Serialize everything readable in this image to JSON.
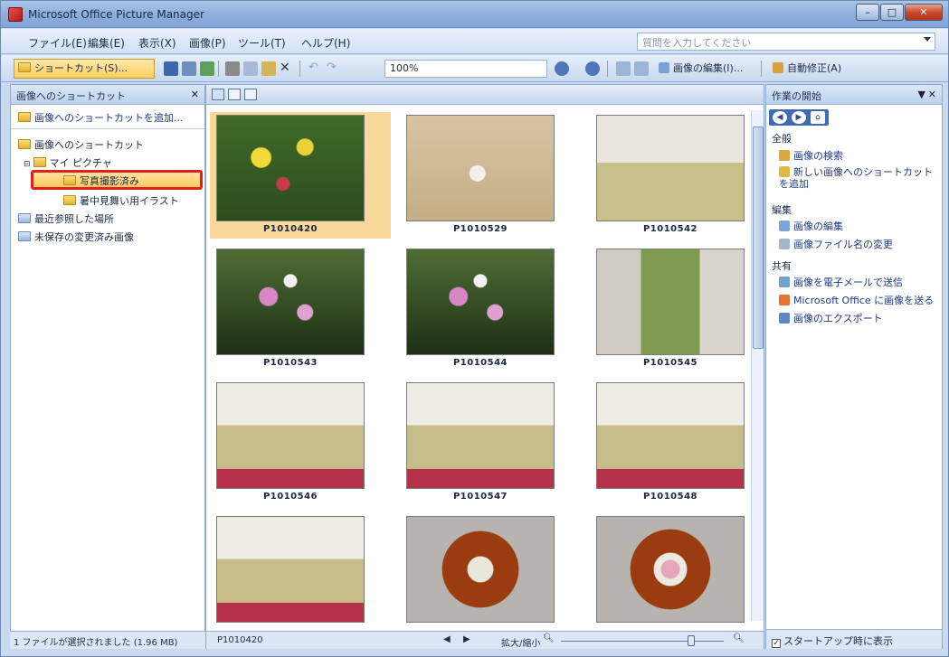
{
  "window": {
    "title": "Microsoft Office Picture Manager"
  },
  "menu": {
    "items": [
      "ファイル(E)",
      "編集(E)",
      "表示(X)",
      "画像(P)",
      "ツール(T)",
      "ヘルプ(H)"
    ],
    "help_placeholder": "質問を入力してください"
  },
  "toolbar": {
    "shortcut_label": "ショートカット(S)...",
    "zoom_value": "100%",
    "edit_label": "画像の編集(I)...",
    "autofix_label": "自動修正(A)"
  },
  "left_pane": {
    "title": "画像へのショートカット",
    "add_link": "画像へのショートカットを追加...",
    "tree": {
      "root": "画像へのショートカット",
      "my_pictures": "マイ ピクチャ",
      "selected_folder": "写真撮影済み",
      "sub_folder": "暑中見舞い用イラスト",
      "recent": "最近参照した場所",
      "unsaved": "未保存の変更済み画像"
    },
    "status": "1 ファイルが選択されました (1.96 MB)"
  },
  "thumbnails": [
    {
      "label": "P1010420",
      "scene": "flowers-yellow"
    },
    {
      "label": "P1010529",
      "scene": "ikebana"
    },
    {
      "label": "P1010542",
      "scene": "tatami-room"
    },
    {
      "label": "P1010543",
      "scene": "pink-flowers"
    },
    {
      "label": "P1010544",
      "scene": "pink-flowers"
    },
    {
      "label": "P1010545",
      "scene": "planter"
    },
    {
      "label": "P1010546",
      "scene": "tatami-people"
    },
    {
      "label": "P1010547",
      "scene": "tatami-people"
    },
    {
      "label": "P1010548",
      "scene": "tatami-people"
    },
    {
      "label": "",
      "scene": "tatami-people"
    },
    {
      "label": "",
      "scene": "wagashi-green"
    },
    {
      "label": "",
      "scene": "wagashi-pink"
    }
  ],
  "center_status": {
    "filename": "P1010420",
    "zoom_label": "拡大/縮小"
  },
  "right_pane": {
    "title": "作業の開始",
    "section_search": "全般",
    "link_find": "画像の検索",
    "link_add_shortcut": "新しい画像へのショートカットを追加",
    "section_edit": "編集",
    "link_edit": "画像の編集",
    "link_rename": "画像ファイル名の変更",
    "section_share": "共有",
    "link_mail": "画像を電子メールで送信",
    "link_send": "Microsoft Office に画像を送る",
    "link_export": "画像のエクスポート",
    "footer_checkbox": "スタートアップ時に表示"
  }
}
